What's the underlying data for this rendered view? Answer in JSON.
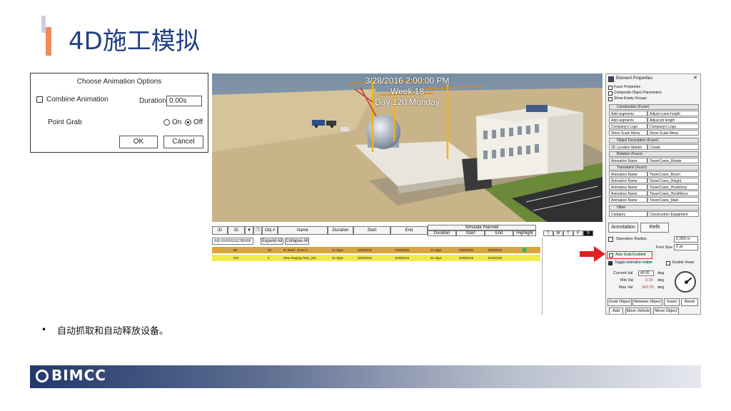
{
  "slide": {
    "title": "4D施工模拟",
    "bullet": "自动抓取和自动释放设备。",
    "footer_logo": "BIMCC"
  },
  "dialog": {
    "title": "Choose Animation Options",
    "combine_label": "Combine Animation",
    "combine_checked": false,
    "duration_label": "Duration",
    "duration_value": "0.00s",
    "point_grab_label": "Point Grab",
    "radio_on": "On",
    "radio_off": "Off",
    "selected": "Off",
    "ok": "OK",
    "cancel": "Cancel"
  },
  "scene": {
    "date_line": "3/28/2016 2:00:00 PM",
    "week_line": "Week 18",
    "day_line": "Day 120 Monday"
  },
  "gantt": {
    "headers": [
      "ID",
      "ID",
      "Obj #",
      "Name",
      "Duration",
      "Start",
      "End"
    ],
    "simulate_label": "Simulate Planned",
    "sub_headers": [
      "Duration",
      "Start",
      "End",
      "Highlight"
    ],
    "day_cols": [
      "T",
      "W",
      "T",
      "F",
      "S"
    ],
    "sid_value": "SID:010926332780000",
    "expand_all": "Expand All",
    "collapse_all": "Collapse All",
    "rows": [
      {
        "id": "56",
        "obj": "46",
        "name": "IP Steel - Zone 6",
        "duration": "21 days",
        "start": "3/28/2016",
        "end": "4/18/2016",
        "sduration": "21 days",
        "sstart": "3/28/2016",
        "send": "4/18/2016",
        "color": "#d9a441"
      },
      {
        "id": "224",
        "obj": "1",
        "name": "New Staging Task_224",
        "duration": "21 days",
        "start": "3/28/2016",
        "end": "4/18/2016",
        "sduration": "21 days",
        "sstart": "3/28/2016",
        "send": "4/18/2016",
        "color": "#f2ea4a"
      }
    ]
  },
  "panel": {
    "title": "Element Properties",
    "fuzor_properties": "Fuzor Properties",
    "composite": "Composite Object Parameters",
    "show_empty": "Show Empty Groups",
    "sec_construction": "Construction (Fuzor)",
    "construction_rows": [
      [
        "Add segments",
        "Adjust crane height"
      ],
      [
        "Add segments",
        "Adjust jib length"
      ],
      [
        "Company's Logo",
        "Company's Logo"
      ],
      [
        "Show Scale Menu",
        "Show Scale Menu"
      ]
    ],
    "sec_object_desc": "Object Description (Fuzor)",
    "object_desc_rows": [
      [
        "3D Location Marker",
        "Create"
      ]
    ],
    "sec_rotation": "Rotation (Fuzor)",
    "rotation_rows": [
      [
        "Animation Name",
        "TowerCrane_Rotate"
      ]
    ],
    "sec_translation": "Translation (Fuzor)",
    "translation_rows": [
      [
        "Animation Name",
        "TowerCrane_Boom"
      ],
      [
        "Animation Name",
        "TowerCrane_Height"
      ],
      [
        "Animation Name",
        "TowerCrane_HookDrop"
      ],
      [
        "Animation Name",
        "TowerCrane_HookMove"
      ],
      [
        "Animation Name",
        "TowerCrane_Main"
      ]
    ],
    "sec_other": "Other",
    "other_rows": [
      [
        "Category",
        "Construction Equipment"
      ]
    ],
    "annotation": "Annotation",
    "refit": "Refit",
    "operation_radius": "Operation Radius",
    "radius_value": "0.000 m",
    "font_size_label": "Font Size",
    "font_size_value": "0 pt",
    "auto_grab": "Auto Grab Enabled",
    "toggle_helper": "Toggle animation helper",
    "enable_views": "Enable Views",
    "current_val_label": "Current Val",
    "current_val": "40.00",
    "min_val_label": "Min Val",
    "min_val": "0.00",
    "max_val_label": "Max Val",
    "max_val": "360.00",
    "deg": "deg",
    "grab_object": "Grab Object",
    "release_object": "Release Object",
    "insert": "Insert",
    "reset": "Reset",
    "add": "Add",
    "move_vehicle": "Move Vehicle",
    "move_object": "Move Object",
    "highlight_color": "#e02020"
  }
}
